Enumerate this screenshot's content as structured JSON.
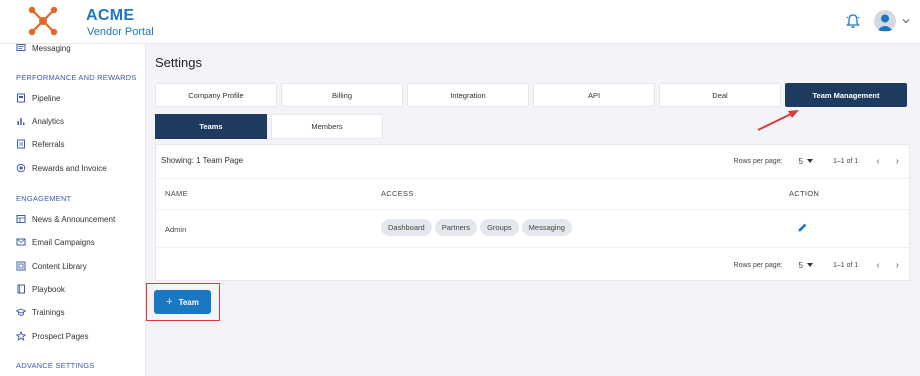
{
  "brand": {
    "name": "ACME",
    "subtitle": "Vendor Portal"
  },
  "sidebar": {
    "items_top": [
      {
        "label": "Messaging",
        "icon": "chat-icon"
      }
    ],
    "sections": [
      {
        "title": "PERFORMANCE AND REWARDS",
        "items": [
          {
            "label": "Pipeline",
            "icon": "pipeline-icon"
          },
          {
            "label": "Analytics",
            "icon": "bar-chart-icon"
          },
          {
            "label": "Referrals",
            "icon": "referral-icon"
          },
          {
            "label": "Rewards and Invoice",
            "icon": "coin-icon"
          }
        ]
      },
      {
        "title": "ENGAGEMENT",
        "items": [
          {
            "label": "News & Announcement",
            "icon": "news-icon"
          },
          {
            "label": "Email Campaigns",
            "icon": "mail-icon"
          },
          {
            "label": "Content Library",
            "icon": "library-icon"
          },
          {
            "label": "Playbook",
            "icon": "book-icon"
          },
          {
            "label": "Trainings",
            "icon": "graduation-icon"
          },
          {
            "label": "Prospect Pages",
            "icon": "star-icon"
          }
        ]
      },
      {
        "title": "ADVANCE SETTINGS",
        "items": []
      }
    ]
  },
  "page": {
    "title": "Settings"
  },
  "tabs": [
    "Company Profile",
    "Billing",
    "Integration",
    "API",
    "Deal",
    "Team Management"
  ],
  "active_tab": "Team Management",
  "subtabs": [
    "Teams",
    "Members"
  ],
  "active_subtab": "Teams",
  "table": {
    "showing": "Showing: 1 Team Page",
    "rows_per_page_label_top": "Rows per page:",
    "rows_per_page_label_bottom": "Rows per page:",
    "rows_per_page": "5",
    "range": "1–1 of 1",
    "columns": [
      "NAME",
      "ACCESS",
      "ACTION"
    ],
    "rows": [
      {
        "name": "Admin",
        "access": [
          "Dashboard",
          "Partners",
          "Groups",
          "Messaging"
        ]
      }
    ]
  },
  "add_button": {
    "label": "Team"
  },
  "colors": {
    "accent": "#1a78c2",
    "navy": "#1f3a5f",
    "highlight": "#e03838"
  }
}
